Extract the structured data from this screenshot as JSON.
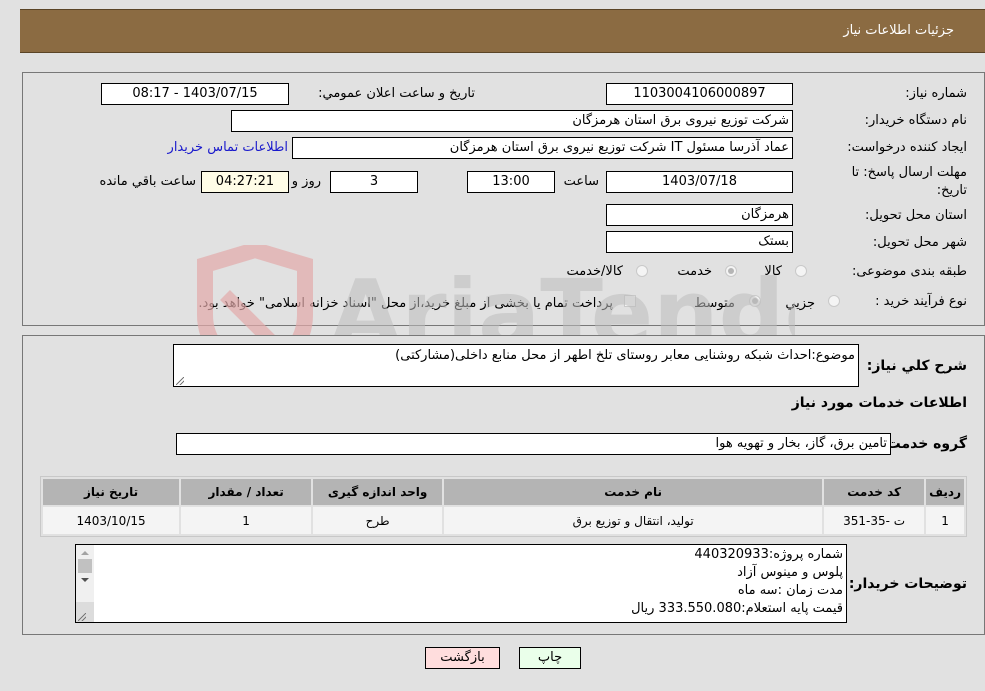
{
  "header": {
    "title": "جزئیات اطلاعات نیاز"
  },
  "form": {
    "need_number": {
      "label": "شماره نیاز:",
      "value": "1103004106000897"
    },
    "announce_datetime": {
      "label": "تاریخ و ساعت اعلان عمومي:",
      "value": "1403/07/15 - 08:17"
    },
    "buyer_org": {
      "label": "نام دستگاه خریدار:",
      "value": "شرکت توزیع نیروی برق استان هرمزگان"
    },
    "requester": {
      "label": "ایجاد کننده درخواست:",
      "value": "عماد آذرسا مسئول IT شرکت توزیع نیروی برق استان هرمزگان"
    },
    "buyer_contact_link": "اطلاعات تماس خریدار",
    "deadline": {
      "label_line1": "مهلت ارسال پاسخ: تا",
      "label_line2": "تاریخ:",
      "date": "1403/07/18",
      "time_label": "ساعت",
      "time": "13:00",
      "days": "3",
      "days_label": "روز و",
      "remaining": "04:27:21",
      "remaining_label": "ساعت باقي مانده"
    },
    "delivery_province": {
      "label": "استان محل تحویل:",
      "value": "هرمزگان"
    },
    "delivery_city": {
      "label": "شهر محل تحویل:",
      "value": "بستک"
    },
    "category": {
      "label": "طبقه بندی موضوعی:",
      "options": [
        "کالا",
        "خدمت",
        "کالا/خدمت"
      ],
      "selected": "خدمت"
    },
    "purchase_process": {
      "label": "نوع فرآیند خرید :",
      "options": [
        "جزیي",
        "متوسط"
      ],
      "selected": "متوسط",
      "treasury_note": "پرداخت تمام یا بخشی از مبلغ خرید،از محل \"اسناد خزانه اسلامی\" خواهد بود.",
      "treasury_checked": false
    }
  },
  "details": {
    "description_label": "شرح كلي نیاز:",
    "description_value": "موضوع:احداث شبکه روشنایی معابر روستای تلخ اطهر از محل منابع داخلی(مشارکتی)",
    "services_heading": "اطلاعات خدمات مورد نیاز",
    "service_group_label": "گروه خدمت:",
    "service_group_value": "تامین برق، گاز، بخار و تهویه هوا",
    "table": {
      "headers": [
        "ردیف",
        "کد خدمت",
        "نام خدمت",
        "واحد اندازه گیری",
        "تعداد / مقدار",
        "تاریخ نیاز"
      ],
      "rows": [
        [
          "1",
          "ت -35-351",
          "تولید، انتقال و توزیع برق",
          "طرح",
          "1",
          "1403/10/15"
        ]
      ]
    },
    "buyer_notes_label": "توضیحات خریدار:",
    "buyer_notes_lines": [
      "شماره پروژه:440320933",
      " پلوس و مینوس آزاد",
      "مدت زمان :سه ماه",
      "قیمت پایه استعلام:333.550.080 ریال"
    ]
  },
  "buttons": {
    "print": "چاپ",
    "back": "بازگشت"
  },
  "colors": {
    "header_bg": "#8b6b42",
    "back_button_bg": "#ffdddd",
    "print_button_bg": "#eaffea",
    "link": "#1a1acc"
  }
}
